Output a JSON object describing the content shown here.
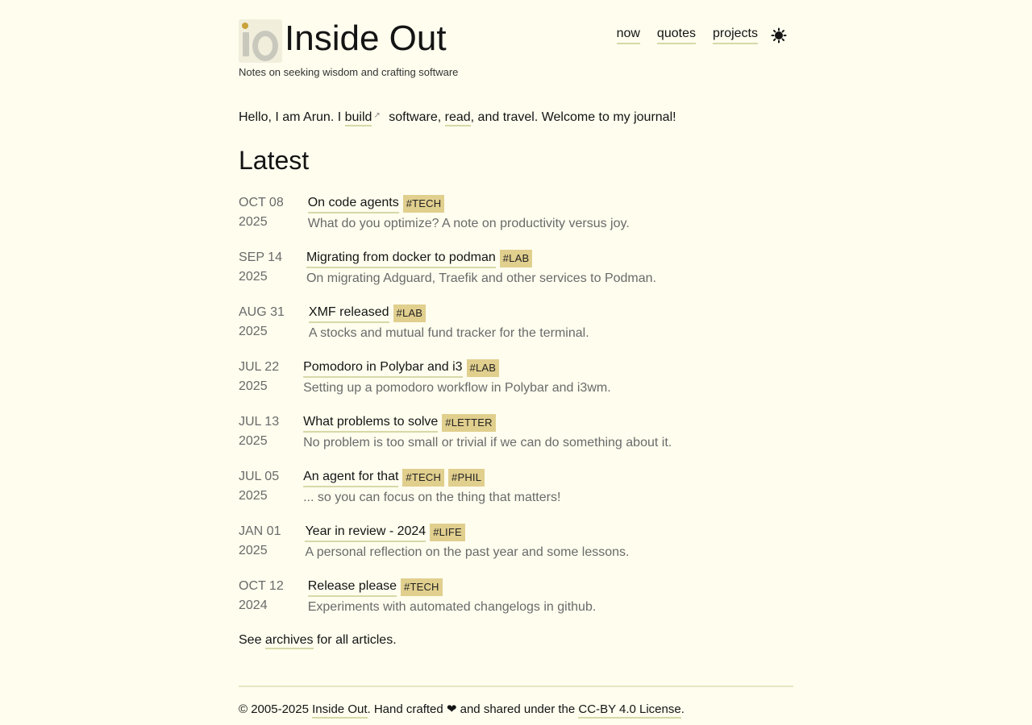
{
  "site": {
    "logo_text": "io",
    "title": "Inside Out",
    "tagline": "Notes on seeking wisdom and crafting software"
  },
  "nav": {
    "items": [
      {
        "label": "now"
      },
      {
        "label": "quotes"
      },
      {
        "label": "projects"
      }
    ],
    "theme_toggle_icon": "sun-icon"
  },
  "intro": {
    "prefix": "Hello, I am Arun. I ",
    "build_link": "build",
    "external_mark": "↗",
    "middle": " software, ",
    "read_link": "read",
    "suffix": ", and travel. Welcome to my journal!"
  },
  "latest_heading": "Latest",
  "posts": [
    {
      "date_md": "OCT 08",
      "year": "2025",
      "title": "On code agents",
      "tags": [
        "#TECH"
      ],
      "desc": "What do you optimize? A note on productivity versus joy."
    },
    {
      "date_md": "SEP 14",
      "year": "2025",
      "title": "Migrating from docker to podman",
      "tags": [
        "#LAB"
      ],
      "desc": "On migrating Adguard, Traefik and other services to Podman."
    },
    {
      "date_md": "AUG 31",
      "year": "2025",
      "title": "XMF released",
      "tags": [
        "#LAB"
      ],
      "desc": "A stocks and mutual fund tracker for the terminal."
    },
    {
      "date_md": "JUL 22",
      "year": "2025",
      "title": "Pomodoro in Polybar and i3",
      "tags": [
        "#LAB"
      ],
      "desc": "Setting up a pomodoro workflow in Polybar and i3wm."
    },
    {
      "date_md": "JUL 13",
      "year": "2025",
      "title": "What problems to solve",
      "tags": [
        "#LETTER"
      ],
      "desc": "No problem is too small or trivial if we can do something about it."
    },
    {
      "date_md": "JUL 05",
      "year": "2025",
      "title": "An agent for that",
      "tags": [
        "#TECH",
        "#PHIL"
      ],
      "desc": "... so you can focus on the thing that matters!"
    },
    {
      "date_md": "JAN 01",
      "year": "2025",
      "title": "Year in review - 2024",
      "tags": [
        "#LIFE"
      ],
      "desc": "A personal reflection on the past year and some lessons."
    },
    {
      "date_md": "OCT 12",
      "year": "2024",
      "title": "Release please",
      "tags": [
        "#TECH"
      ],
      "desc": "Experiments with automated changelogs in github."
    }
  ],
  "archives": {
    "prefix": "See ",
    "link": "archives",
    "suffix": " for all articles."
  },
  "footer": {
    "prefix": "© 2005-2025 ",
    "site_link": "Inside Out",
    "middle": ". Hand crafted ❤ and shared under the ",
    "license_link": "CC-BY 4.0 License",
    "suffix": "."
  },
  "colors": {
    "background": "#fefdee",
    "tag_bg": "#e1cf8e",
    "link_underline": "#d6d9a8",
    "muted_text": "#6a6a6a"
  }
}
